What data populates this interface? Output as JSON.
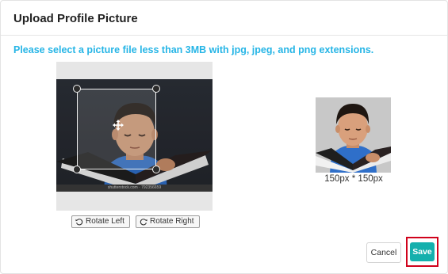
{
  "modal": {
    "title": "Upload Profile Picture",
    "hint": "Please select a picture file less than 3MB with jpg, jpeg, and png extensions."
  },
  "cropper": {
    "watermark": "shutterstock.com · 792356659",
    "rotate_left_label": "Rotate Left",
    "rotate_right_label": "Rotate Right"
  },
  "preview": {
    "caption": "150px * 150px"
  },
  "footer": {
    "cancel_label": "Cancel",
    "save_label": "Save"
  },
  "colors": {
    "hint": "#26b5e6",
    "save": "#14b0ad",
    "highlight": "#d0021b"
  },
  "icons": {
    "rotate_left": "rotate-left-icon",
    "rotate_right": "rotate-right-icon",
    "move": "move-icon"
  }
}
